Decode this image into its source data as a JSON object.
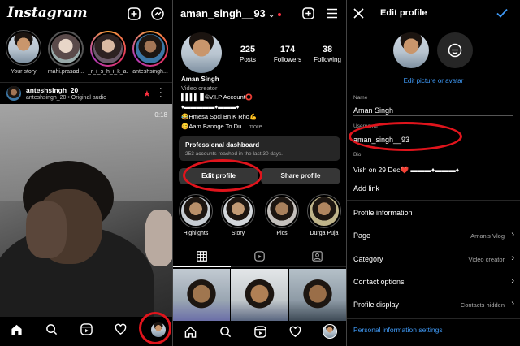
{
  "feed": {
    "logo": "Instagram",
    "stories": [
      {
        "name": "Your story"
      },
      {
        "name": "mahi.prasad..."
      },
      {
        "name": "_r_i_s_h_i_k_a..."
      },
      {
        "name": "anteshsingh..."
      }
    ],
    "post": {
      "username": "anteshsingh_20",
      "subline": "anteshsingh_20 • Original audio",
      "timer": "0:18"
    }
  },
  "profile": {
    "username": "aman_singh__93",
    "stats": [
      {
        "value": "225",
        "label": "Posts"
      },
      {
        "value": "174",
        "label": "Followers"
      },
      {
        "value": "38",
        "label": "Following"
      }
    ],
    "name": "Aman Singh",
    "category": "Video creator",
    "bio_lines": [
      "▌▌▌▌ ▊©V.I.P Account⭕",
      "♦▬▬▬▬▬♦▬▬▬♦",
      "😂Hmesa Spcl Bn K Rho💪",
      "😊Aam Banoge To Du..."
    ],
    "bio_more": "more",
    "dashboard_title": "Professional dashboard",
    "dashboard_sub": "253 accounts reached in the last 30 days.",
    "edit_button": "Edit profile",
    "share_button": "Share profile",
    "highlights": [
      {
        "label": "Highlights"
      },
      {
        "label": "Story"
      },
      {
        "label": "Pics"
      },
      {
        "label": "Durga Puja"
      }
    ]
  },
  "edit": {
    "title": "Edit profile",
    "edit_picture": "Edit picture or avatar",
    "name_label": "Name",
    "name_value": "Aman Singh",
    "username_label": "Username",
    "username_value": "aman_singh__93",
    "bio_label": "Bio",
    "bio_value": "Vish on 29 Dec❤️ ▬▬▬♦▬▬▬♦",
    "add_link": "Add link",
    "profile_information": "Profile information",
    "rows": [
      {
        "label": "Page",
        "value": "Aman's Vlog"
      },
      {
        "label": "Category",
        "value": "Video creator"
      },
      {
        "label": "Contact options",
        "value": ""
      },
      {
        "label": "Profile display",
        "value": "Contacts hidden"
      }
    ],
    "personal_settings": "Personal information settings"
  },
  "colors": {
    "accent_blue": "#3f9af7",
    "annotation_red": "#e0141c",
    "like_red": "#ff3040"
  }
}
